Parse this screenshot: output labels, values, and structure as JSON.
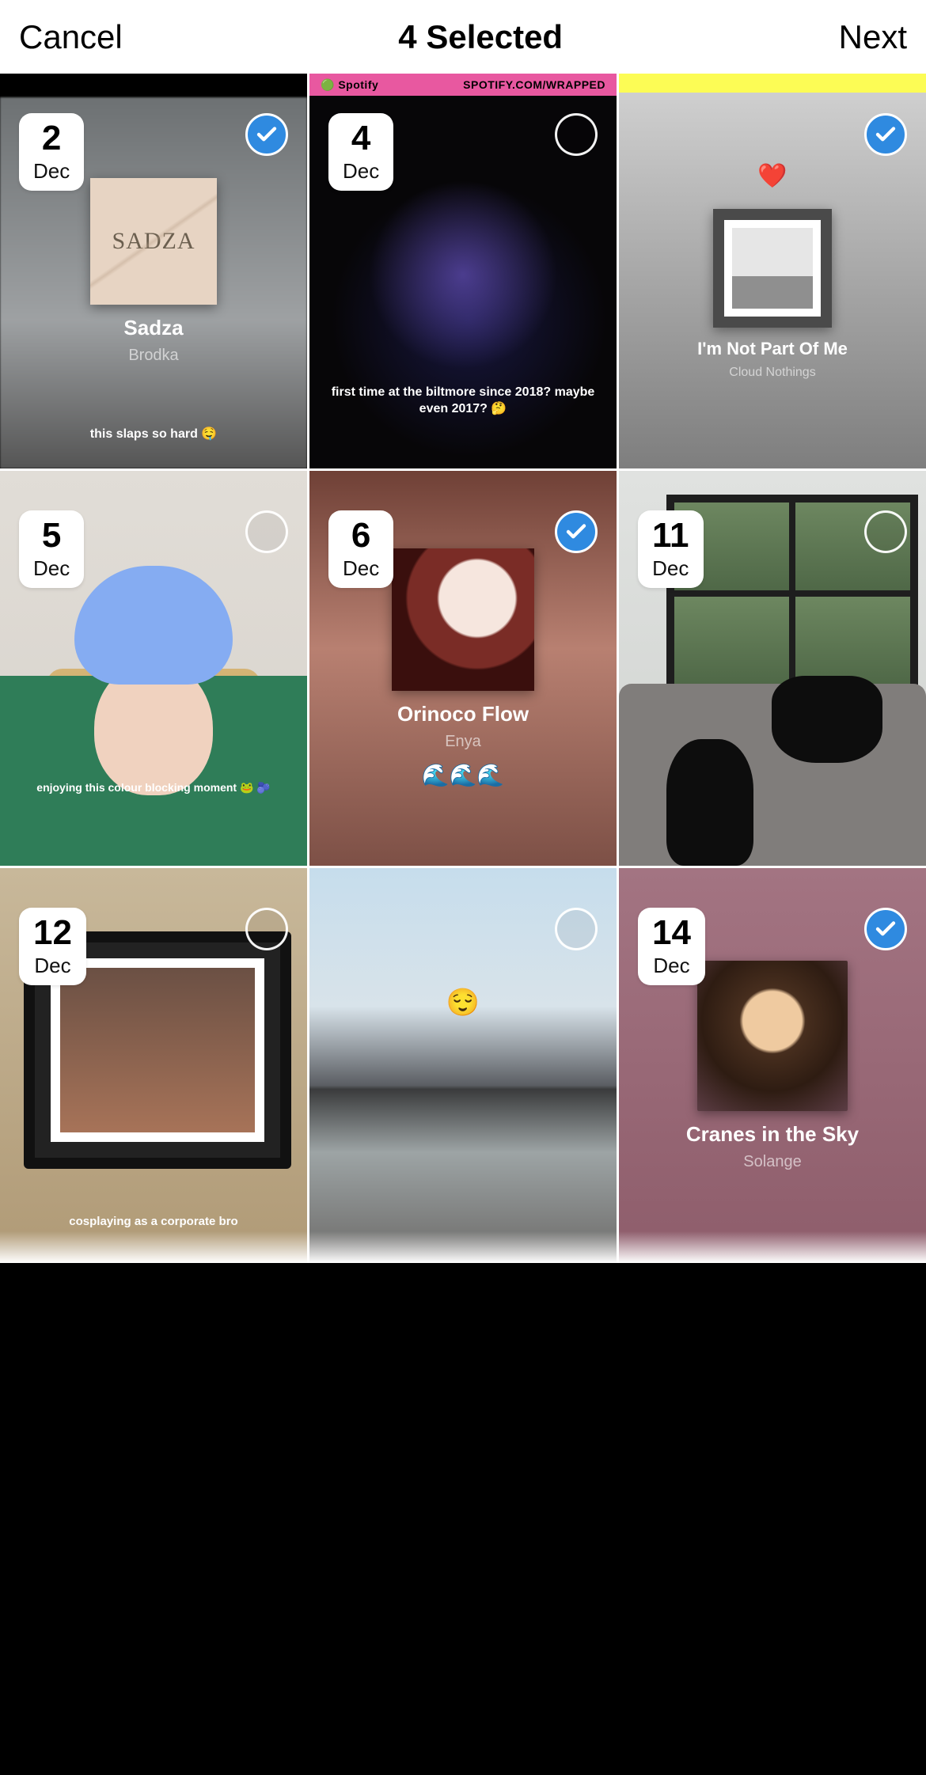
{
  "header": {
    "cancel": "Cancel",
    "title": "4 Selected",
    "next": "Next"
  },
  "tiles": [
    {
      "day": "2",
      "month": "Dec",
      "selected": true,
      "song": "Sadza",
      "artist": "Brodka",
      "albumText": "SADZA",
      "caption": "this slaps so hard 🤤"
    },
    {
      "day": "4",
      "month": "Dec",
      "selected": false,
      "spotifyBrand": "Spotify",
      "spotifyUrl": "SPOTIFY.COM/WRAPPED",
      "caption": "first time at the biltmore since 2018? maybe even 2017? 🤔"
    },
    {
      "day": "",
      "month": "",
      "selected": true,
      "heart": "❤️",
      "song": "I'm Not Part Of Me",
      "artist": "Cloud Nothings"
    },
    {
      "day": "5",
      "month": "Dec",
      "selected": false,
      "caption": "enjoying this colour blocking moment 🐸 🫐"
    },
    {
      "day": "6",
      "month": "Dec",
      "selected": true,
      "song": "Orinoco Flow",
      "artist": "Enya",
      "waves": "🌊🌊🌊"
    },
    {
      "day": "11",
      "month": "Dec",
      "selected": false
    },
    {
      "day": "12",
      "month": "Dec",
      "selected": false,
      "caption": "cosplaying as a corporate bro"
    },
    {
      "day": "",
      "month": "",
      "selected": false,
      "emoji": "😌"
    },
    {
      "day": "14",
      "month": "Dec",
      "selected": true,
      "song": "Cranes in the Sky",
      "artist": "Solange"
    }
  ]
}
